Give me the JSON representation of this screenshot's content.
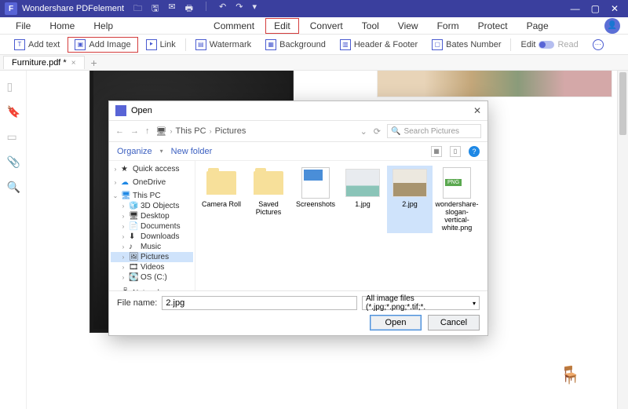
{
  "titlebar": {
    "appname": "Wondershare PDFelement"
  },
  "menu": {
    "file": "File",
    "home": "Home",
    "help": "Help",
    "comment": "Comment",
    "edit": "Edit",
    "convert": "Convert",
    "tool": "Tool",
    "view": "View",
    "form": "Form",
    "protect": "Protect",
    "page": "Page"
  },
  "toolbar": {
    "addtext": "Add text",
    "addimage": "Add Image",
    "link": "Link",
    "watermark": "Watermark",
    "background": "Background",
    "headerfooter": "Header & Footer",
    "bates": "Bates Number",
    "edit": "Edit",
    "read": "Read"
  },
  "tab": {
    "name": "Furniture.pdf *"
  },
  "dialog": {
    "title": "Open",
    "crumb1": "This PC",
    "crumb2": "Pictures",
    "search_placeholder": "Search Pictures",
    "organize": "Organize",
    "newfolder": "New folder",
    "tree": {
      "quickaccess": "Quick access",
      "onedrive": "OneDrive",
      "thispc": "This PC",
      "objects3d": "3D Objects",
      "desktop": "Desktop",
      "documents": "Documents",
      "downloads": "Downloads",
      "music": "Music",
      "pictures": "Pictures",
      "videos": "Videos",
      "osc": "OS (C:)",
      "network": "Network"
    },
    "files": {
      "cameraroll": "Camera Roll",
      "savedpictures": "Saved Pictures",
      "screenshots": "Screenshots",
      "f1": "1.jpg",
      "f2": "2.jpg",
      "f3": "wondershare-slogan-vertical-white.png",
      "png_badge": "PNG"
    },
    "filename_label": "File name:",
    "filename_value": "2.jpg",
    "filter": "All image files (*.jpg;*.png;*.tif;*.",
    "open": "Open",
    "cancel": "Cancel"
  }
}
